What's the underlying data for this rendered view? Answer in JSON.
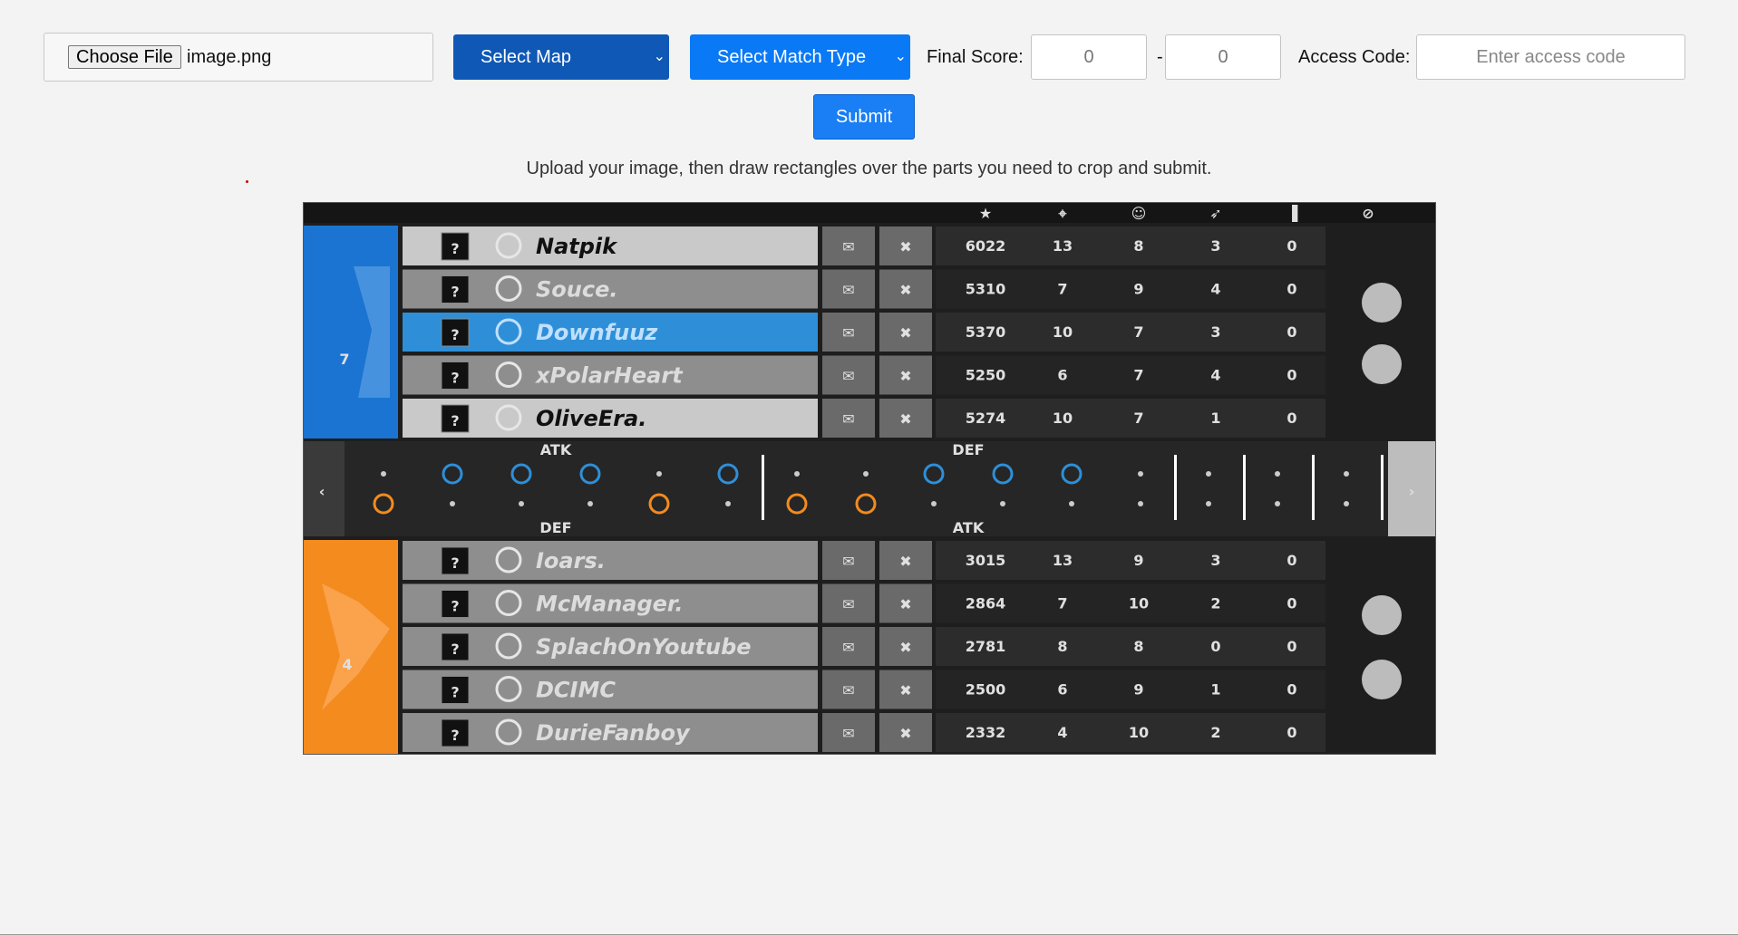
{
  "file_input": {
    "button_label": "Choose File",
    "file_name": "image.png"
  },
  "map_select": {
    "label": "Select Map"
  },
  "match_type_select": {
    "label": "Select Match Type"
  },
  "final_score": {
    "label": "Final Score:",
    "left_value": "0",
    "separator": "-",
    "right_value": "0"
  },
  "access_code": {
    "label": "Access Code:",
    "placeholder": "Enter access code"
  },
  "submit_label": "Submit",
  "instructions": "Upload your image, then draw rectangles over the parts you need to crop and submit.",
  "scoreboard": {
    "team_top": {
      "score": "7",
      "color": "#1b74d1"
    },
    "team_bottom": {
      "score": "4",
      "color": "#f38b1e"
    },
    "round_bar": {
      "top_left": "ATK",
      "top_right": "DEF",
      "bottom_left": "DEF",
      "bottom_right": "ATK"
    },
    "top_players": [
      {
        "name": "Natpik",
        "score": "6022",
        "kills": "13",
        "assists": "8",
        "deaths": "3",
        "ping": "0",
        "highlight": false,
        "bold": true
      },
      {
        "name": "Souce.",
        "score": "5310",
        "kills": "7",
        "assists": "9",
        "deaths": "4",
        "ping": "0",
        "highlight": false,
        "bold": false
      },
      {
        "name": "Downfuuz",
        "score": "5370",
        "kills": "10",
        "assists": "7",
        "deaths": "3",
        "ping": "0",
        "highlight": true,
        "bold": false
      },
      {
        "name": "xPolarHeart",
        "score": "5250",
        "kills": "6",
        "assists": "7",
        "deaths": "4",
        "ping": "0",
        "highlight": false,
        "bold": false
      },
      {
        "name": "OliveEra.",
        "score": "5274",
        "kills": "10",
        "assists": "7",
        "deaths": "1",
        "ping": "0",
        "highlight": false,
        "bold": true
      }
    ],
    "bottom_players": [
      {
        "name": "Ioars.",
        "score": "3015",
        "kills": "13",
        "assists": "9",
        "deaths": "3",
        "ping": "0"
      },
      {
        "name": "McManager.",
        "score": "2864",
        "kills": "7",
        "assists": "10",
        "deaths": "2",
        "ping": "0"
      },
      {
        "name": "SplachOnYoutube",
        "score": "2781",
        "kills": "8",
        "assists": "8",
        "deaths": "0",
        "ping": "0"
      },
      {
        "name": "DCIMC",
        "score": "2500",
        "kills": "6",
        "assists": "9",
        "deaths": "1",
        "ping": "0"
      },
      {
        "name": "DurieFanboy",
        "score": "2332",
        "kills": "4",
        "assists": "10",
        "deaths": "2",
        "ping": "0"
      }
    ]
  }
}
